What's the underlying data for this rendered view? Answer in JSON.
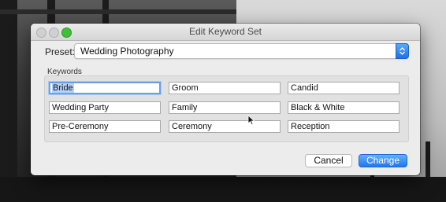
{
  "window": {
    "title": "Edit Keyword Set"
  },
  "preset": {
    "label": "Preset:",
    "selected": "Wedding Photography"
  },
  "keywords": {
    "group_label": "Keywords",
    "fields": [
      "Bride",
      "Groom",
      "Candid",
      "Wedding Party",
      "Family",
      "Black & White",
      "Pre-Ceremony",
      "Ceremony",
      "Reception"
    ]
  },
  "buttons": {
    "cancel": "Cancel",
    "change": "Change"
  },
  "colors": {
    "accent": "#1f77ee",
    "zoom": "#3fbf3a",
    "selection": "#b5d3f7"
  },
  "icons": [
    "stepper-arrows-icon",
    "mouse-cursor-icon"
  ]
}
